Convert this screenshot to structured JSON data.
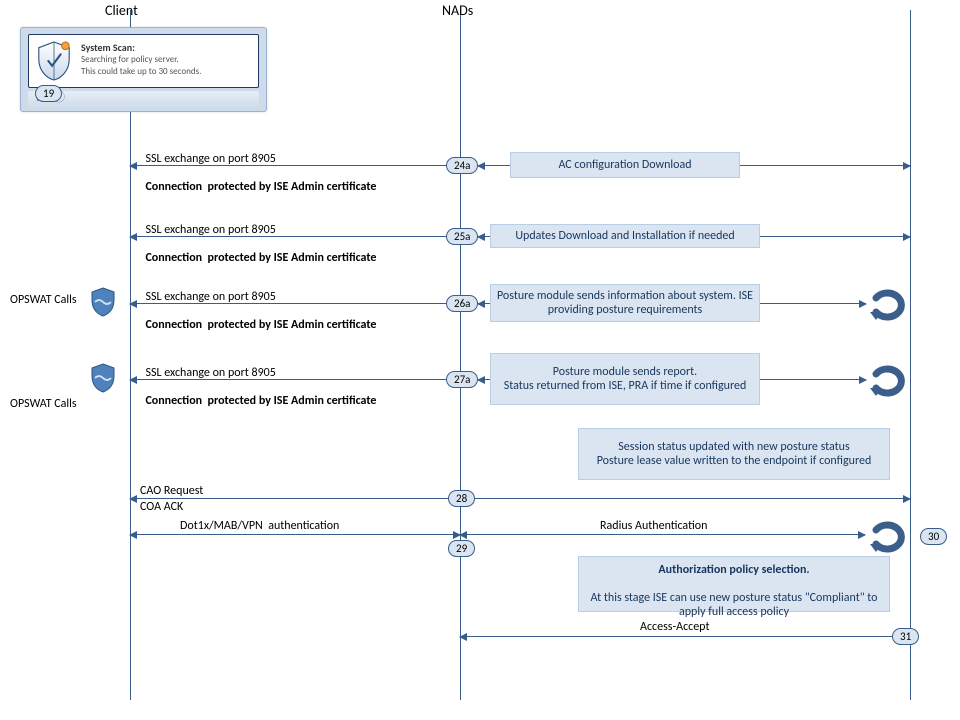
{
  "columns": {
    "client": "Client",
    "nads": "NADs"
  },
  "client_widget": {
    "title": "System Scan:",
    "line1": "Searching for policy server.",
    "line2": "This could take up to 30 seconds."
  },
  "opswat_label": "OPSWAT Calls",
  "ssl_line": "SSL exchange on port 8905",
  "ssl_bold": "Connection  protected by ISE Admin certificate",
  "boxes": {
    "ac_config": "AC configuration Download",
    "updates": "Updates Download and Installation if needed",
    "posture_info": "Posture module sends information about system. ISE providing posture requirements",
    "posture_report": "Posture module sends report.\nStatus returned from ISE, PRA if time if configured",
    "session_status": "Session status updated with new posture status\nPosture lease value written to the endpoint if configured",
    "authz": "Authorization  policy selection.\nAt this stage ISE can use new posture status \"Compliant\" to apply full access policy"
  },
  "msgs": {
    "cao_req": "CAO Request",
    "coa_ack": "COA ACK",
    "dot1x": "Dot1x/MAB/VPN  authentication",
    "radius": "Radius Authentication",
    "access_accept": "Access-Accept"
  },
  "badges": {
    "b19": "19",
    "b24a": "24a",
    "b25a": "25a",
    "b26a": "26a",
    "b27a": "27a",
    "b28": "28",
    "b29": "29",
    "b30": "30",
    "b31": "31"
  }
}
